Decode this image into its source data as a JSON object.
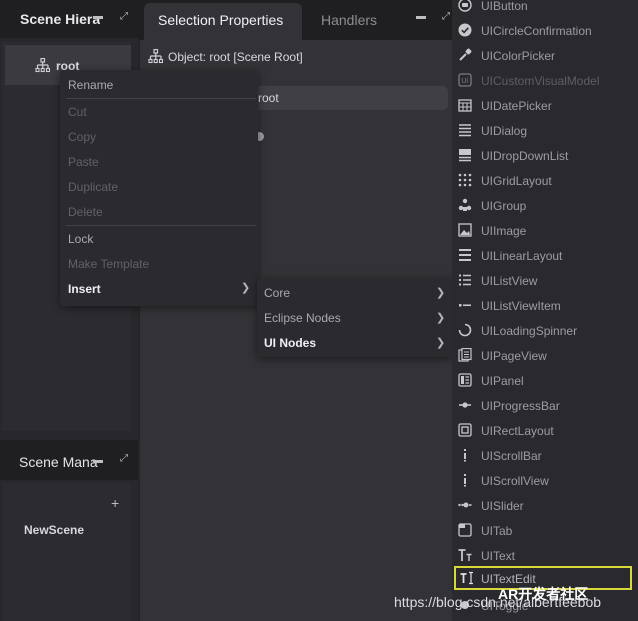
{
  "scene_hierarchy": {
    "title": "Scene Hiera",
    "root_label": "root"
  },
  "scene_manager": {
    "title": "Scene Mana",
    "add_label": "+",
    "scenes": [
      "NewScene"
    ]
  },
  "tabs": {
    "selection_properties": "Selection Properties",
    "handlers": "Handlers"
  },
  "properties": {
    "object_label": "Object: root [Scene Root]",
    "name_value": "root"
  },
  "context_menu": {
    "items": [
      {
        "label": "Rename",
        "enabled": true
      },
      {
        "label": "Cut",
        "enabled": false
      },
      {
        "label": "Copy",
        "enabled": false
      },
      {
        "label": "Paste",
        "enabled": false
      },
      {
        "label": "Duplicate",
        "enabled": false
      },
      {
        "label": "Delete",
        "enabled": false
      },
      {
        "label": "Lock",
        "enabled": true
      },
      {
        "label": "Make Template",
        "enabled": false
      },
      {
        "label": "Insert",
        "enabled": true,
        "has_submenu": true
      }
    ]
  },
  "insert_submenu": {
    "items": [
      {
        "label": "Core",
        "has_submenu": true
      },
      {
        "label": "Eclipse Nodes",
        "has_submenu": true
      },
      {
        "label": "UI Nodes",
        "has_submenu": true
      }
    ]
  },
  "ui_nodes": [
    {
      "label": "UIButton",
      "icon": "button-icon"
    },
    {
      "label": "UICircleConfirmation",
      "icon": "check-circle-icon"
    },
    {
      "label": "UIColorPicker",
      "icon": "eyedropper-icon"
    },
    {
      "label": "UICustomVisualModel",
      "icon": "custom-model-icon"
    },
    {
      "label": "UIDatePicker",
      "icon": "calendar-icon"
    },
    {
      "label": "UIDialog",
      "icon": "dialog-icon"
    },
    {
      "label": "UIDropDownList",
      "icon": "dropdown-icon"
    },
    {
      "label": "UIGridLayout",
      "icon": "grid-icon"
    },
    {
      "label": "UIGroup",
      "icon": "group-icon"
    },
    {
      "label": "UIImage",
      "icon": "image-icon"
    },
    {
      "label": "UILinearLayout",
      "icon": "linear-layout-icon"
    },
    {
      "label": "UIListView",
      "icon": "list-icon"
    },
    {
      "label": "UIListViewItem",
      "icon": "list-item-icon"
    },
    {
      "label": "UILoadingSpinner",
      "icon": "spinner-icon"
    },
    {
      "label": "UIPageView",
      "icon": "page-view-icon"
    },
    {
      "label": "UIPanel",
      "icon": "panel-icon"
    },
    {
      "label": "UIProgressBar",
      "icon": "progress-bar-icon"
    },
    {
      "label": "UIRectLayout",
      "icon": "rect-layout-icon"
    },
    {
      "label": "UIScrollBar",
      "icon": "scrollbar-icon"
    },
    {
      "label": "UIScrollView",
      "icon": "scroll-view-icon"
    },
    {
      "label": "UISlider",
      "icon": "slider-icon"
    },
    {
      "label": "UITab",
      "icon": "tab-icon"
    },
    {
      "label": "UIText",
      "icon": "text-icon"
    },
    {
      "label": "UITextEdit",
      "icon": "text-edit-icon"
    },
    {
      "label": "UIToggle",
      "icon": "toggle-icon"
    }
  ],
  "watermark": {
    "url_text": "https://blog.csdn.net/albertfeebob",
    "overlay_text": "AR开发者社区"
  }
}
